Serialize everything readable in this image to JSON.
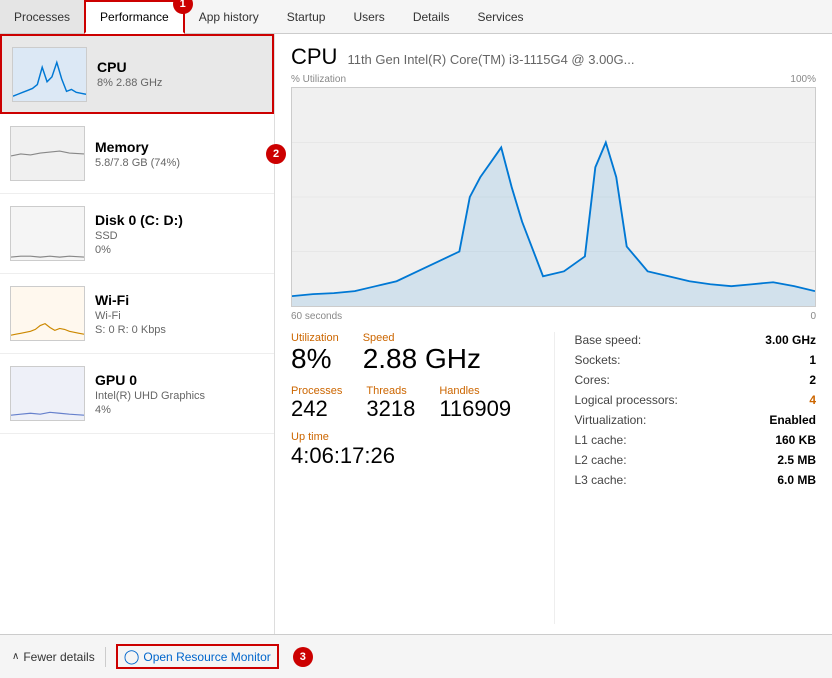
{
  "tabs": [
    {
      "id": "processes",
      "label": "Processes",
      "active": false
    },
    {
      "id": "performance",
      "label": "Performance",
      "active": true
    },
    {
      "id": "app-history",
      "label": "App history",
      "active": false
    },
    {
      "id": "startup",
      "label": "Startup",
      "active": false
    },
    {
      "id": "users",
      "label": "Users",
      "active": false
    },
    {
      "id": "details",
      "label": "Details",
      "active": false
    },
    {
      "id": "services",
      "label": "Services",
      "active": false
    }
  ],
  "sidebar": {
    "items": [
      {
        "id": "cpu",
        "name": "CPU",
        "sub1": "8% 2.88 GHz",
        "sub2": "",
        "selected": true,
        "thumb_type": "cpu"
      },
      {
        "id": "memory",
        "name": "Memory",
        "sub1": "5.8/7.8 GB (74%)",
        "sub2": "",
        "selected": false,
        "thumb_type": "mem"
      },
      {
        "id": "disk",
        "name": "Disk 0 (C: D:)",
        "sub1": "SSD",
        "sub2": "0%",
        "selected": false,
        "thumb_type": "disk"
      },
      {
        "id": "wifi",
        "name": "Wi-Fi",
        "sub1": "Wi-Fi",
        "sub2": "S: 0 R: 0 Kbps",
        "selected": false,
        "thumb_type": "wifi"
      },
      {
        "id": "gpu",
        "name": "GPU 0",
        "sub1": "Intel(R) UHD Graphics",
        "sub2": "4%",
        "selected": false,
        "thumb_type": "gpu"
      }
    ]
  },
  "cpu_panel": {
    "title": "CPU",
    "model": "11th Gen Intel(R) Core(TM) i3-1115G4 @ 3.00G...",
    "chart_label_left": "% Utilization",
    "chart_label_right": "100%",
    "chart_time_left": "60 seconds",
    "chart_time_right": "0",
    "utilization_label": "Utilization",
    "utilization_value": "8%",
    "speed_label": "Speed",
    "speed_value": "2.88 GHz",
    "processes_label": "Processes",
    "processes_value": "242",
    "threads_label": "Threads",
    "threads_value": "3218",
    "handles_label": "Handles",
    "handles_value": "116909",
    "uptime_label": "Up time",
    "uptime_value": "4:06:17:26",
    "right_stats": [
      {
        "label": "Base speed:",
        "value": "3.00 GHz",
        "highlight": false
      },
      {
        "label": "Sockets:",
        "value": "1",
        "highlight": false
      },
      {
        "label": "Cores:",
        "value": "2",
        "highlight": false
      },
      {
        "label": "Logical processors:",
        "value": "4",
        "highlight": true
      },
      {
        "label": "Virtualization:",
        "value": "Enabled",
        "highlight": false,
        "bold": true
      },
      {
        "label": "L1 cache:",
        "value": "160 KB",
        "highlight": false
      },
      {
        "label": "L2 cache:",
        "value": "2.5 MB",
        "highlight": false
      },
      {
        "label": "L3 cache:",
        "value": "6.0 MB",
        "highlight": false
      }
    ]
  },
  "footer": {
    "fewer_details_label": "Fewer details",
    "open_resource_monitor_label": "Open Resource Monitor"
  },
  "annotations": {
    "tab_annotation": "1",
    "arrow_annotation": "2",
    "footer_annotation": "3"
  }
}
